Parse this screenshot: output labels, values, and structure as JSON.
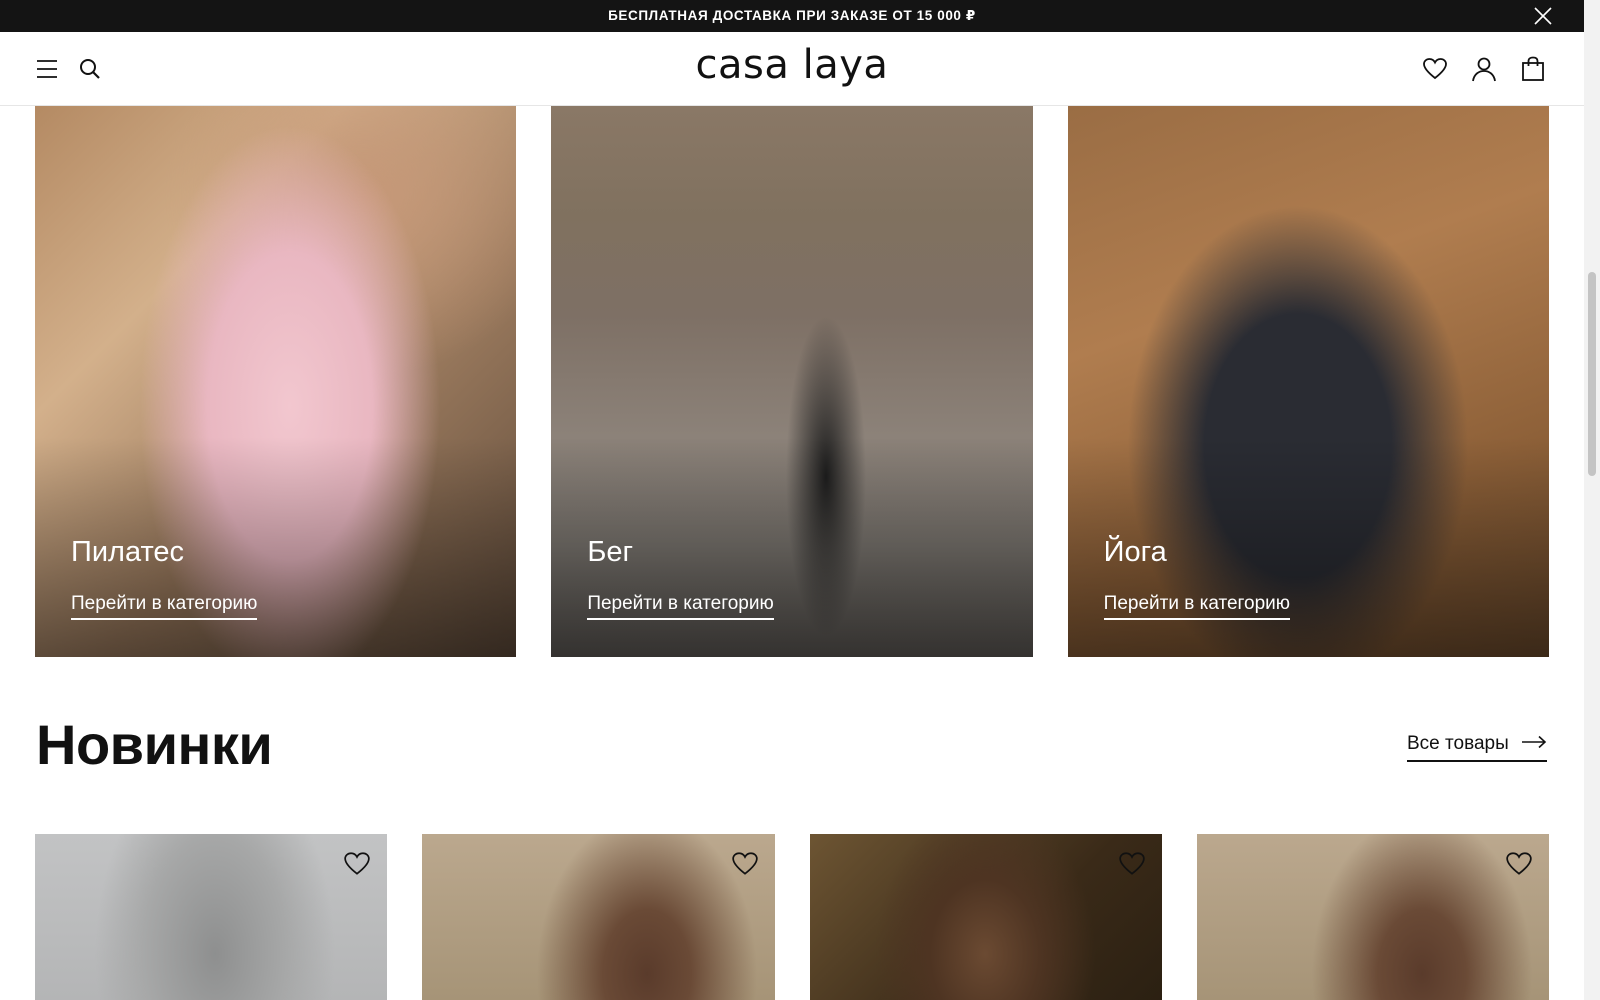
{
  "announcement": {
    "text": "БЕСПЛАТНАЯ ДОСТАВКА ПРИ ЗАКАЗЕ ОТ 15 000 ₽",
    "close_icon": "close-icon"
  },
  "header": {
    "logo": "casa laya",
    "left_icons": [
      "menu-icon",
      "search-icon"
    ],
    "right_icons": [
      "heart-icon",
      "account-icon",
      "bag-icon"
    ]
  },
  "categories": [
    {
      "title": "Пилатес",
      "link": "Перейти в категорию"
    },
    {
      "title": "Бег",
      "link": "Перейти в категорию"
    },
    {
      "title": "Йога",
      "link": "Перейти в категорию"
    }
  ],
  "new_arrivals": {
    "title": "Новинки",
    "all_link": "Все товары"
  },
  "products": [
    {
      "wishlist_icon": "heart-icon"
    },
    {
      "wishlist_icon": "heart-icon"
    },
    {
      "wishlist_icon": "heart-icon"
    },
    {
      "wishlist_icon": "heart-icon"
    }
  ]
}
